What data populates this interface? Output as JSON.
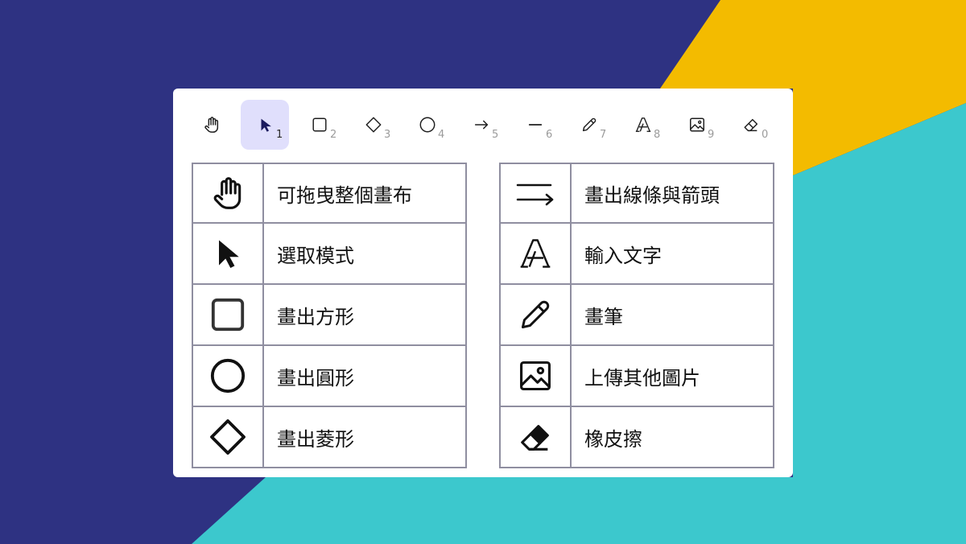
{
  "colors": {
    "navy": "#2e3282",
    "yellow": "#f3bb00",
    "teal": "#3cc8cd",
    "active_bg": "#e0dffc"
  },
  "toolbar": [
    {
      "icon": "hand-icon",
      "key": ""
    },
    {
      "icon": "cursor-icon",
      "key": "1",
      "active": true
    },
    {
      "icon": "square-icon",
      "key": "2"
    },
    {
      "icon": "diamond-icon",
      "key": "3"
    },
    {
      "icon": "circle-icon",
      "key": "4"
    },
    {
      "icon": "arrow-icon",
      "key": "5"
    },
    {
      "icon": "line-icon",
      "key": "6"
    },
    {
      "icon": "pencil-icon",
      "key": "7"
    },
    {
      "icon": "text-icon",
      "key": "8"
    },
    {
      "icon": "image-icon",
      "key": "9"
    },
    {
      "icon": "eraser-icon",
      "key": "0"
    }
  ],
  "legend_left": [
    {
      "icon": "hand-icon",
      "label": "可拖曳整個畫布"
    },
    {
      "icon": "cursor-icon",
      "label": "選取模式"
    },
    {
      "icon": "square-icon",
      "label": "畫出方形"
    },
    {
      "icon": "circle-icon",
      "label": "畫出圓形"
    },
    {
      "icon": "diamond-icon",
      "label": "畫出菱形"
    }
  ],
  "legend_right": [
    {
      "icon": "line-arrow-icon",
      "label": "畫出線條與箭頭"
    },
    {
      "icon": "text-icon",
      "label": "輸入文字"
    },
    {
      "icon": "pencil-icon",
      "label": "畫筆"
    },
    {
      "icon": "image-icon",
      "label": "上傳其他圖片"
    },
    {
      "icon": "eraser-icon",
      "label": "橡皮擦"
    }
  ]
}
